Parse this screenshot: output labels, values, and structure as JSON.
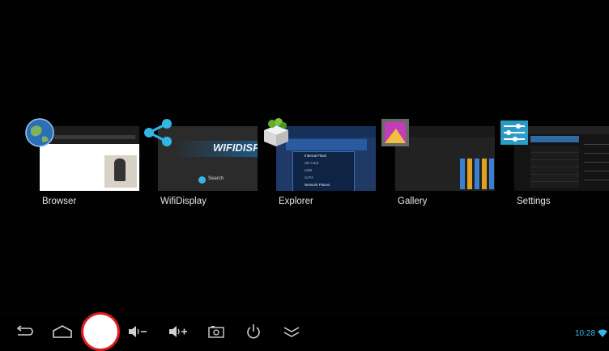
{
  "recents": {
    "apps": [
      {
        "label": "Browser",
        "icon": "globe-icon"
      },
      {
        "label": "WifiDisplay",
        "icon": "share-icon"
      },
      {
        "label": "Explorer",
        "icon": "explorer-box-icon"
      },
      {
        "label": "Gallery",
        "icon": "gallery-icon"
      },
      {
        "label": "Settings",
        "icon": "settings-sliders-icon"
      }
    ],
    "wifidisplay_thumb": {
      "logo_text": "WIFIDISP",
      "search_text": "Search"
    },
    "explorer_thumb": {
      "items": [
        "Internal Flash",
        "SD Card",
        "USB",
        "SATA",
        "Network Places"
      ]
    }
  },
  "navbar": {
    "buttons": [
      "back-icon",
      "home-icon",
      "volume-down-icon",
      "volume-up-icon",
      "screenshot-icon",
      "power-icon",
      "hide-bar-icon"
    ]
  },
  "status": {
    "time": "10:28",
    "icon": "wifi-icon"
  },
  "colors": {
    "accent": "#33b5e5",
    "record_ring": "#e11a1a"
  }
}
